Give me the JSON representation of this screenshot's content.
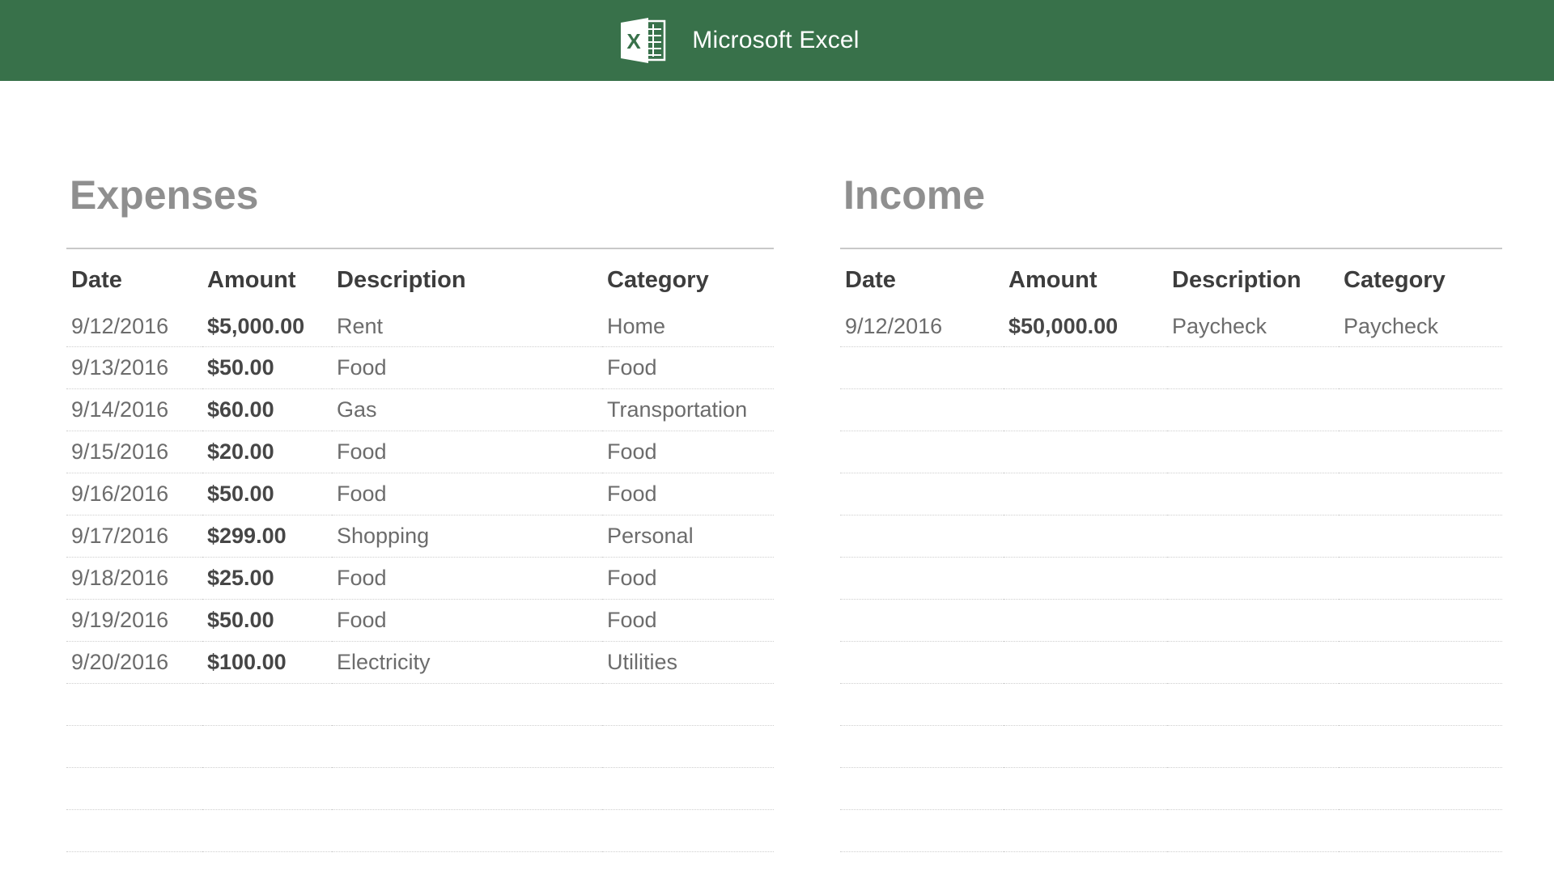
{
  "header": {
    "app_name": "Microsoft Excel",
    "logo_icon": "excel-logo-icon",
    "bar_color": "#38714a"
  },
  "expenses": {
    "title": "Expenses",
    "columns": [
      "Date",
      "Amount",
      "Description",
      "Category"
    ],
    "rows": [
      {
        "date": "9/12/2016",
        "amount": "$5,000.00",
        "description": "Rent",
        "category": "Home"
      },
      {
        "date": "9/13/2016",
        "amount": "$50.00",
        "description": "Food",
        "category": "Food"
      },
      {
        "date": "9/14/2016",
        "amount": "$60.00",
        "description": "Gas",
        "category": "Transportation"
      },
      {
        "date": "9/15/2016",
        "amount": "$20.00",
        "description": "Food",
        "category": "Food"
      },
      {
        "date": "9/16/2016",
        "amount": "$50.00",
        "description": "Food",
        "category": "Food"
      },
      {
        "date": "9/17/2016",
        "amount": "$299.00",
        "description": "Shopping",
        "category": "Personal"
      },
      {
        "date": "9/18/2016",
        "amount": "$25.00",
        "description": "Food",
        "category": "Food"
      },
      {
        "date": "9/19/2016",
        "amount": "$50.00",
        "description": "Food",
        "category": "Food"
      },
      {
        "date": "9/20/2016",
        "amount": "$100.00",
        "description": "Electricity",
        "category": "Utilities"
      },
      {
        "date": "",
        "amount": "",
        "description": "",
        "category": ""
      },
      {
        "date": "",
        "amount": "",
        "description": "",
        "category": ""
      },
      {
        "date": "",
        "amount": "",
        "description": "",
        "category": ""
      },
      {
        "date": "",
        "amount": "",
        "description": "",
        "category": ""
      }
    ]
  },
  "income": {
    "title": "Income",
    "columns": [
      "Date",
      "Amount",
      "Description",
      "Category"
    ],
    "rows": [
      {
        "date": "9/12/2016",
        "amount": "$50,000.00",
        "description": "Paycheck",
        "category": "Paycheck"
      },
      {
        "date": "",
        "amount": "",
        "description": "",
        "category": ""
      },
      {
        "date": "",
        "amount": "",
        "description": "",
        "category": ""
      },
      {
        "date": "",
        "amount": "",
        "description": "",
        "category": ""
      },
      {
        "date": "",
        "amount": "",
        "description": "",
        "category": ""
      },
      {
        "date": "",
        "amount": "",
        "description": "",
        "category": ""
      },
      {
        "date": "",
        "amount": "",
        "description": "",
        "category": ""
      },
      {
        "date": "",
        "amount": "",
        "description": "",
        "category": ""
      },
      {
        "date": "",
        "amount": "",
        "description": "",
        "category": ""
      },
      {
        "date": "",
        "amount": "",
        "description": "",
        "category": ""
      },
      {
        "date": "",
        "amount": "",
        "description": "",
        "category": ""
      },
      {
        "date": "",
        "amount": "",
        "description": "",
        "category": ""
      },
      {
        "date": "",
        "amount": "",
        "description": "",
        "category": ""
      }
    ]
  }
}
